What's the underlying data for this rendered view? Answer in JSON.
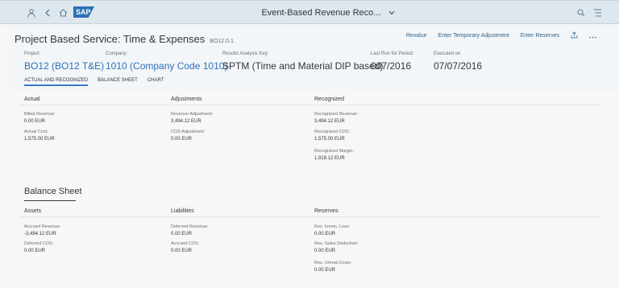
{
  "shell": {
    "title": "Event-Based Revenue Reco...",
    "icons": [
      "person-icon",
      "back-icon",
      "home-icon",
      "search-icon",
      "notifications-icon"
    ],
    "logo_text": "SAP"
  },
  "header": {
    "title": "Project Based Service: Time & Expenses",
    "subtitle": "BO12.0.1",
    "actions": [
      "Revalue",
      "Enter Temporary Adjustment",
      "Enter Reserves"
    ],
    "attributes": [
      {
        "label": "Project:",
        "value": "BO12 (BO12 T&E)"
      },
      {
        "label": "Company:",
        "value": "1010 (Company Code 1010)"
      },
      {
        "label": "Results Analysis Key:",
        "value": "SPTM (Time and Material DIP based)"
      },
      {
        "label": "Last Run for Period:",
        "value": "007/2016"
      },
      {
        "label": "Executed on",
        "value": "07/07/2016"
      }
    ],
    "tabs": [
      "ACTUAL AND RECOGNIZED",
      "BALANCE SHEET",
      "CHART"
    ]
  },
  "actual_section": {
    "actual_h": "Actual",
    "adjust_h": "Adjustments",
    "recog_h": "Recognized",
    "billed_l": "Billed Revenue:",
    "billed_v": "0.00  EUR",
    "actual_cost_l": "Actual Cost:",
    "actual_cost_v": "1,575.00  EUR",
    "rev_adj_l": "Revenue Adjustment:",
    "rev_adj_v": "3,494.12  EUR",
    "cos_adj_l": "COS Adjustment:",
    "cos_adj_v": "0.00  EUR",
    "rec_rev_l": "Recognized Revenue:",
    "rec_rev_v": "3,494.12  EUR",
    "rec_cos_l": "Recognized COS:",
    "rec_cos_v": "1,575.00  EUR",
    "rec_margin_l": "Recognized Margin:",
    "rec_margin_v": "1,919.12  EUR"
  },
  "balance_sheet": {
    "title": "Balance Sheet",
    "assets_h": "Assets",
    "liab_h": "Liabilities",
    "res_h": "Reserves",
    "accrued_rev_l": "Accrued Revenue:",
    "accrued_rev_v": "-3,494.12  EUR",
    "deferred_cos_l": "Deferred COS:",
    "deferred_cos_v": "0.00  EUR",
    "deferred_rev_l": "Deferred Revenue:",
    "deferred_rev_v": "0.00  EUR",
    "accrued_cos_l": "Accrued COS:",
    "accrued_cos_v": "0.00  EUR",
    "res_loss_l": "Res. Immin. Loss:",
    "res_loss_v": "0.00  EUR",
    "res_sales_l": "Res. Sales Deduction:",
    "res_sales_v": "0.00  EUR",
    "res_unreal_l": "Res. Unreal.Costs:",
    "res_unreal_v": "0.00  EUR"
  },
  "colors": {
    "accent": "#2f6fb8",
    "shell": "#dfe7ee",
    "link": "#346187"
  }
}
